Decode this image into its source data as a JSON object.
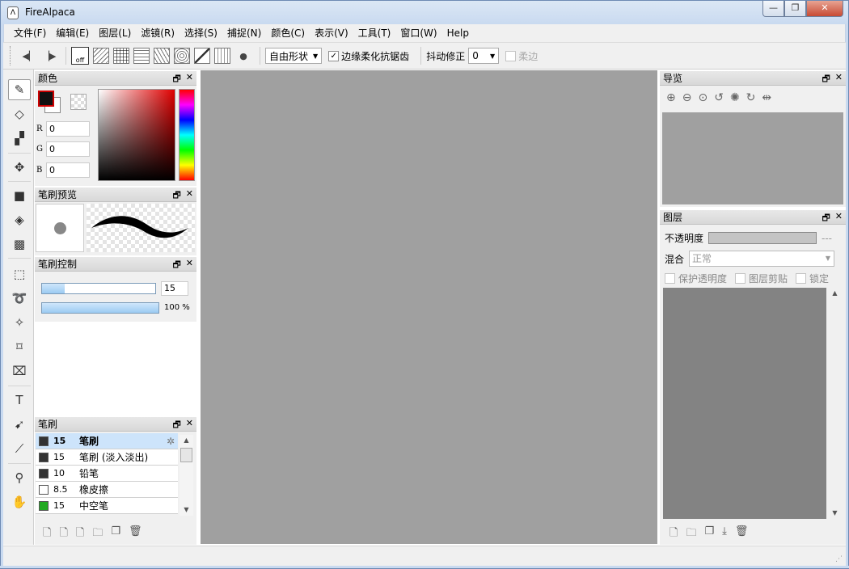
{
  "window": {
    "title": "FireAlpaca",
    "minimize": "—",
    "maximize": "❐",
    "close": "✕"
  },
  "menu": [
    "文件(F)",
    "编辑(E)",
    "图层(L)",
    "滤镜(R)",
    "选择(S)",
    "捕捉(N)",
    "颜色(C)",
    "表示(V)",
    "工具(T)",
    "窗口(W)",
    "Help"
  ],
  "toolbar": {
    "snap_off_label": "off",
    "shape_select": "自由形状",
    "antialias_checked": "✓",
    "antialias_label": "边缘柔化抗锯齿",
    "stabilizer_label": "抖动修正",
    "stabilizer_value": "0",
    "soft_edge_label": "柔边"
  },
  "panels": {
    "color": {
      "title": "颜色",
      "r_label": "R",
      "g_label": "G",
      "b_label": "B",
      "r": "0",
      "g": "0",
      "b": "0"
    },
    "brush_preview": {
      "title": "笔刷预览"
    },
    "brush_control": {
      "title": "笔刷控制",
      "size_value": "15",
      "size_fill": 0.2,
      "opacity_value": "100 %",
      "opacity_fill": 1.0
    },
    "brush": {
      "title": "笔刷",
      "items": [
        {
          "size": "15",
          "name": "笔刷",
          "color": "#333333"
        },
        {
          "size": "15",
          "name": "笔刷 (淡入淡出)",
          "color": "#333333"
        },
        {
          "size": "10",
          "name": "铅笔",
          "color": "#333333"
        },
        {
          "size": "8.5",
          "name": "橡皮擦",
          "color": "#ffffff"
        },
        {
          "size": "15",
          "name": "中空笔",
          "color": "#22aa22"
        }
      ]
    },
    "navigator": {
      "title": "导览"
    },
    "layer": {
      "title": "图层",
      "opacity_label": "不透明度",
      "opacity_value": "---",
      "blend_label": "混合",
      "blend_value": "正常",
      "protect_alpha": "保护透明度",
      "clipping": "图层剪贴",
      "lock": "锁定"
    }
  }
}
